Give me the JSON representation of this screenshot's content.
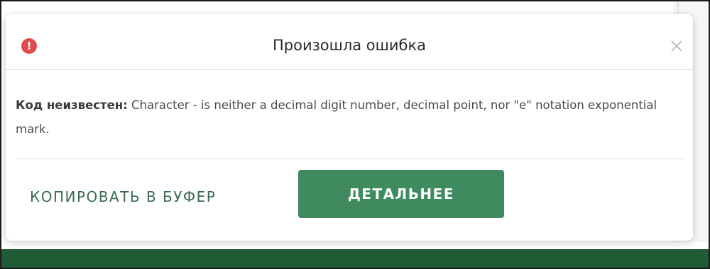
{
  "dialog": {
    "title": "Произошла ошибка",
    "status_icon": "error-exclamation-icon",
    "status_icon_glyph": "!",
    "close_icon": "close-icon",
    "message_label": "Код неизвестен:",
    "message_text": " Character - is neither a decimal digit number, decimal point, nor \"e\" notation exponential mark.",
    "copy_button_label": "КОПИРОВАТЬ В БУФЕР",
    "details_button_label": "ДЕТАЛЬНЕЕ"
  },
  "colors": {
    "accent_green": "#3f8a5e",
    "accent_text_green": "#3c6a51",
    "error_red": "#de4b4b",
    "footer_bar": "#1f5c36"
  }
}
